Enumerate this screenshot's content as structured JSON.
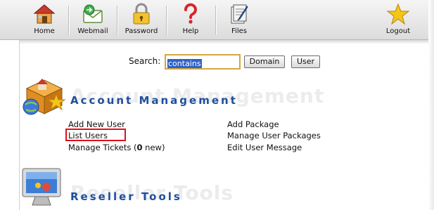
{
  "toolbar": {
    "items": [
      {
        "label": "Home",
        "icon": "house-icon"
      },
      {
        "label": "Webmail",
        "icon": "mail-icon"
      },
      {
        "label": "Password",
        "icon": "padlock-icon"
      },
      {
        "label": "Help",
        "icon": "question-icon"
      },
      {
        "label": "Files",
        "icon": "files-icon"
      },
      {
        "label": "Logout",
        "icon": "star-icon"
      }
    ]
  },
  "search": {
    "label": "Search:",
    "value": "contains",
    "domain_button": "Domain",
    "user_button": "User"
  },
  "account_management": {
    "title": "Account Management",
    "ghost_title": "Account Management",
    "links_left": [
      "Add New User",
      "List Users"
    ],
    "tickets_prefix": "Manage Tickets (",
    "tickets_count": "0",
    "tickets_suffix": " new)",
    "links_right": [
      "Add Package",
      "Manage User Packages",
      "Edit User Message"
    ]
  },
  "reseller_tools": {
    "title": "Reseller Tools",
    "ghost_title": "Reseller Tools"
  },
  "colors": {
    "section_title": "#1f4f9e",
    "highlight": "#e0101a",
    "selection": "#2f63c9"
  }
}
